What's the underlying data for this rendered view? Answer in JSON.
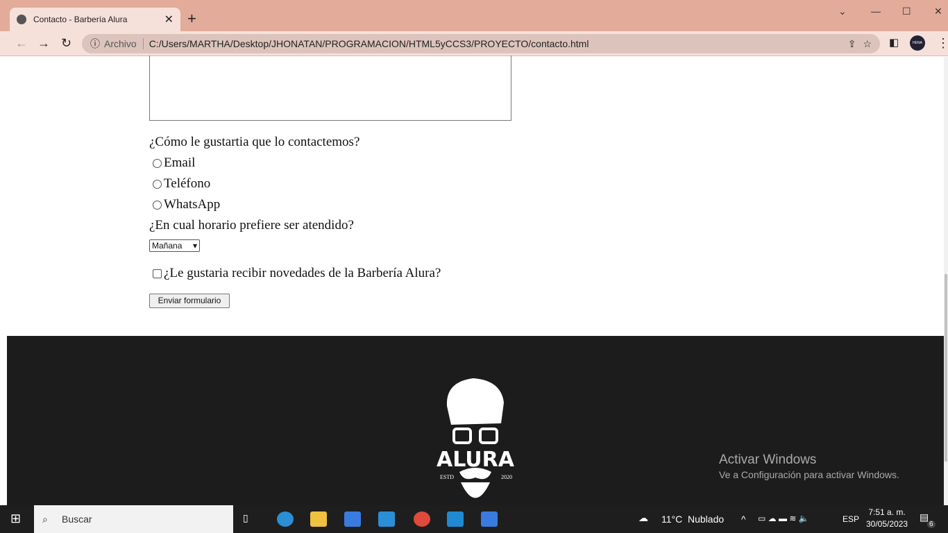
{
  "browser": {
    "tab_title": "Contacto - Barbería Alura",
    "security_label": "Archivo",
    "url": "C:/Users/MARTHA/Desktop/JHONATAN/PROGRAMACION/HTML5yCCS3/PROYECTO/contacto.html",
    "profile": "HENA WARE"
  },
  "form": {
    "contact_question": "¿Cómo le gustartia que lo contactemos?",
    "options": [
      "Email",
      "Teléfono",
      "WhatsApp"
    ],
    "schedule_question": "¿En cual horario prefiere ser atendido?",
    "schedule_value": "Mañana",
    "newsletter_label": "¿Le gustaria recibir novedades de la Barbería Alura?",
    "submit_label": "Enviar formulario"
  },
  "footer": {
    "logo_text": "ALURA",
    "estd": "ESTD",
    "year": "2020"
  },
  "watermark": {
    "title": "Activar Windows",
    "subtitle": "Ve a Configuración para activar Windows."
  },
  "taskbar": {
    "search": "Buscar",
    "weather_temp": "11°C",
    "weather_text": "Nublado",
    "lang": "ESP",
    "time": "7:51 a. m.",
    "date": "30/05/2023",
    "notifications": "6"
  }
}
